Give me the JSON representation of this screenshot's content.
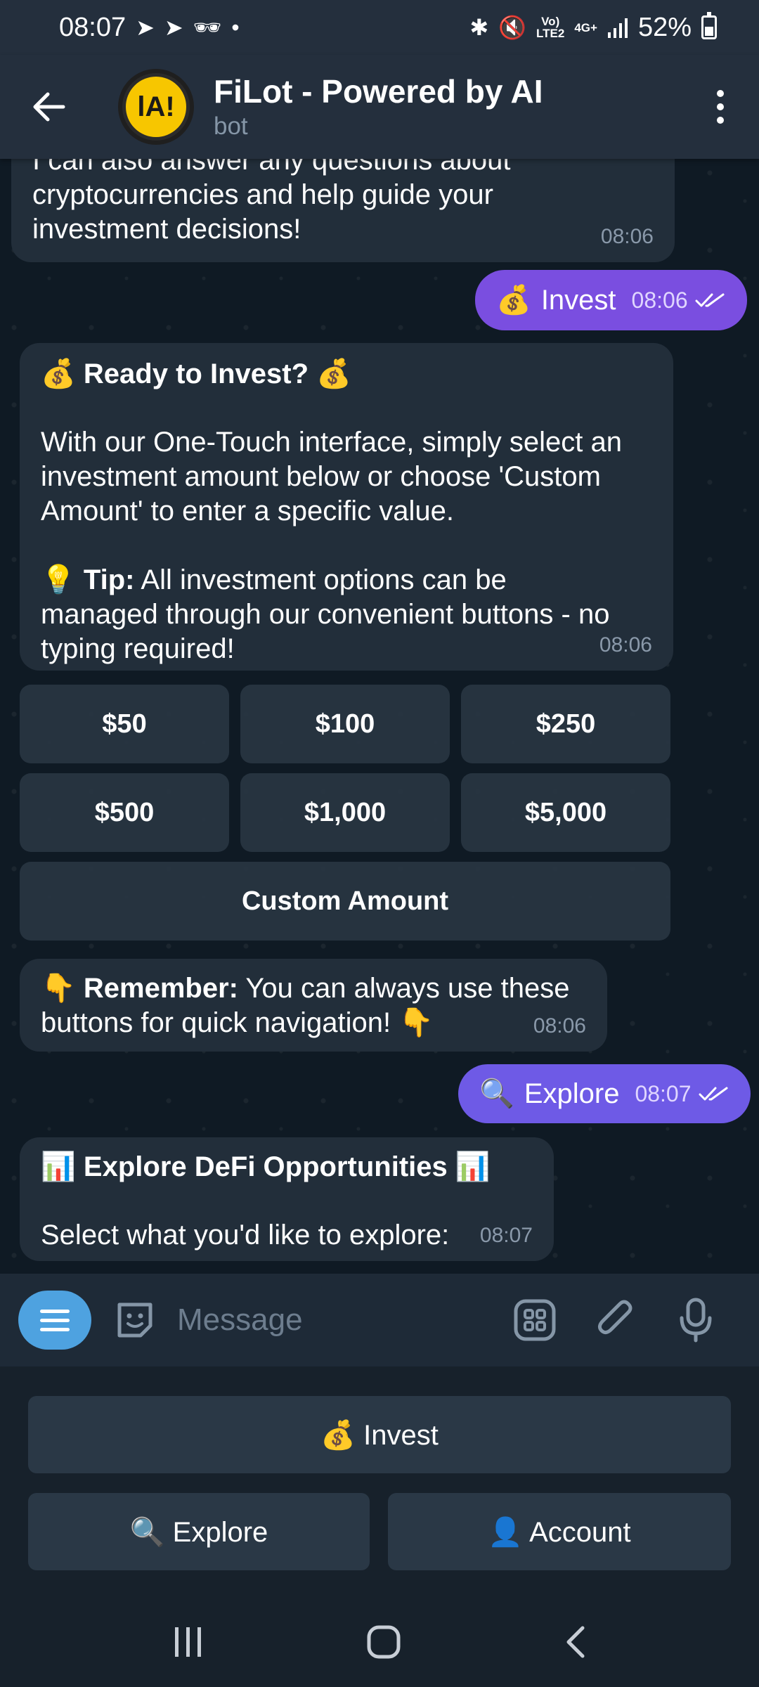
{
  "status_bar": {
    "time": "08:07",
    "network_top": "Vo)",
    "network_bottom": "LTE2",
    "signal_type": "4G+",
    "battery": "52%"
  },
  "header": {
    "title": "FiLot - Powered by AI",
    "subtitle": "bot",
    "avatar_text": "lA!"
  },
  "messages": {
    "m1": {
      "text": "I can also answer any questions about\ncryptocurrencies and help guide your\ninvestment decisions!",
      "time": "08:06"
    },
    "m2": {
      "emoji": "💰",
      "text": "Invest",
      "time": "08:06"
    },
    "m3": {
      "title": "💰 Ready to Invest? 💰",
      "body": "With our One-Touch interface, simply select an\ninvestment amount below or choose 'Custom\nAmount' to enter a specific value.",
      "tip_prefix": "💡 ",
      "tip_label": "Tip:",
      "tip_text": " All investment options can be\nmanaged through our convenient buttons - no\ntyping required!",
      "time": "08:06"
    },
    "m4": {
      "prefix": "👇 ",
      "label": "Remember:",
      "text": " You can always use these\nbuttons for quick navigation! 👇",
      "time": "08:06"
    },
    "m5": {
      "emoji": "🔍",
      "text": "Explore",
      "time": "08:07"
    },
    "m6": {
      "title": "📊 Explore DeFi Opportunities 📊",
      "body": "Select what you'd like to explore:",
      "time": "08:07"
    }
  },
  "amount_buttons": [
    "$50",
    "$100",
    "$250",
    "$500",
    "$1,000",
    "$5,000"
  ],
  "custom_amount": "Custom Amount",
  "input": {
    "placeholder": "Message"
  },
  "keyboard": {
    "invest": "💰 Invest",
    "explore": "🔍 Explore",
    "account": "👤 Account"
  }
}
